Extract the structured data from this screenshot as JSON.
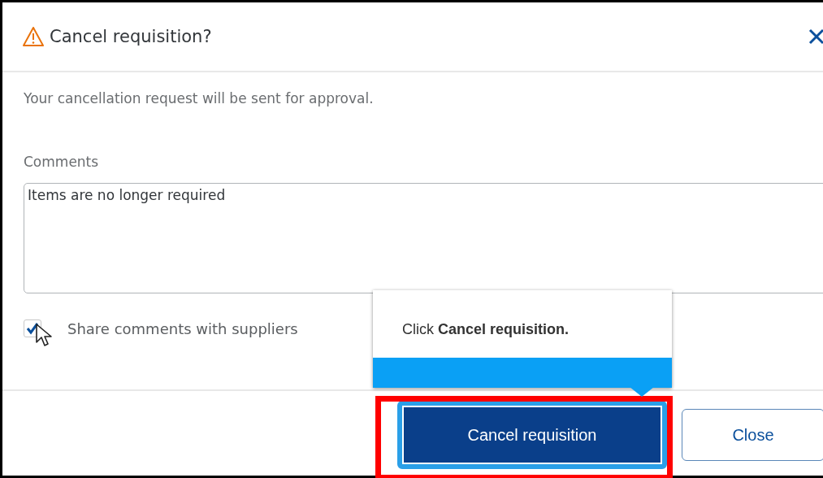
{
  "dialog": {
    "title": "Cancel requisition?",
    "message": "Your cancellation request will be sent for approval.",
    "comments": {
      "label": "Comments",
      "value": "Items are no longer required"
    },
    "share_checkbox": {
      "label": "Share comments with suppliers",
      "checked": true
    },
    "buttons": [
      {
        "label": "Cancel requisition",
        "kind": "primary"
      },
      {
        "label": "Close",
        "kind": "secondary"
      }
    ]
  },
  "tooltip": {
    "text": "Click **Cancel requisition.**"
  }
}
